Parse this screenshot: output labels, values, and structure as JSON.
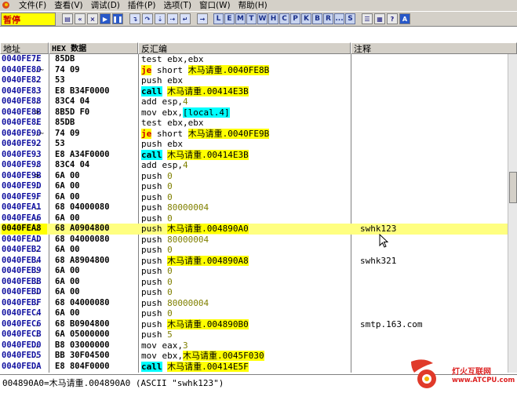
{
  "menu": {
    "items": [
      "文件(F)",
      "查看(V)",
      "调试(D)",
      "插件(P)",
      "选项(T)",
      "窗口(W)",
      "帮助(H)"
    ]
  },
  "toolbar": {
    "status": "暂停",
    "letters": [
      "L",
      "E",
      "M",
      "T",
      "W",
      "H",
      "C",
      "P",
      "K",
      "B",
      "R",
      "...",
      "S"
    ]
  },
  "columns": {
    "address": "地址",
    "hex": "HEX 数据",
    "disasm": "反汇编",
    "comment": "注释"
  },
  "rows": [
    {
      "addr": "0040FE7E",
      "mark": ".",
      "hex": "85DB",
      "asm": [
        {
          "t": "test ebx,ebx"
        }
      ],
      "cmt": ""
    },
    {
      "addr": "0040FE80",
      "mark": ".~",
      "hex": "74 09",
      "asm": [
        {
          "t": "je",
          "c": "jmp"
        },
        {
          "t": " short "
        },
        {
          "t": "木马请重.0040FE8B",
          "c": "tgt"
        }
      ],
      "cmt": ""
    },
    {
      "addr": "0040FE82",
      "mark": ".",
      "hex": "53",
      "asm": [
        {
          "t": "push ebx"
        }
      ],
      "cmt": ""
    },
    {
      "addr": "0040FE83",
      "mark": ".",
      "hex": "E8 B34F0000",
      "asm": [
        {
          "t": "call",
          "c": "call"
        },
        {
          "t": " "
        },
        {
          "t": "木马请重.00414E3B",
          "c": "tgt"
        }
      ],
      "cmt": ""
    },
    {
      "addr": "0040FE88",
      "mark": ".",
      "hex": "83C4 04",
      "asm": [
        {
          "t": "add esp,"
        },
        {
          "t": "4",
          "c": "num"
        }
      ],
      "cmt": ""
    },
    {
      "addr": "0040FE8B",
      "mark": ">",
      "hex": "8B5D F0",
      "asm": [
        {
          "t": "mov ebx,"
        },
        {
          "t": "[local.4]",
          "c": "local"
        }
      ],
      "cmt": ""
    },
    {
      "addr": "0040FE8E",
      "mark": ".",
      "hex": "85DB",
      "asm": [
        {
          "t": "test ebx,ebx"
        }
      ],
      "cmt": ""
    },
    {
      "addr": "0040FE90",
      "mark": ".~",
      "hex": "74 09",
      "asm": [
        {
          "t": "je",
          "c": "jmp"
        },
        {
          "t": " short "
        },
        {
          "t": "木马请重.0040FE9B",
          "c": "tgt"
        }
      ],
      "cmt": ""
    },
    {
      "addr": "0040FE92",
      "mark": ".",
      "hex": "53",
      "asm": [
        {
          "t": "push ebx"
        }
      ],
      "cmt": ""
    },
    {
      "addr": "0040FE93",
      "mark": ".",
      "hex": "E8 A34F0000",
      "asm": [
        {
          "t": "call",
          "c": "call"
        },
        {
          "t": " "
        },
        {
          "t": "木马请重.00414E3B",
          "c": "tgt"
        }
      ],
      "cmt": ""
    },
    {
      "addr": "0040FE98",
      "mark": ".",
      "hex": "83C4 04",
      "asm": [
        {
          "t": "add esp,"
        },
        {
          "t": "4",
          "c": "num"
        }
      ],
      "cmt": ""
    },
    {
      "addr": "0040FE9B",
      "mark": ">",
      "hex": "6A 00",
      "asm": [
        {
          "t": "push "
        },
        {
          "t": "0",
          "c": "num"
        }
      ],
      "cmt": ""
    },
    {
      "addr": "0040FE9D",
      "mark": ".",
      "hex": "6A 00",
      "asm": [
        {
          "t": "push "
        },
        {
          "t": "0",
          "c": "num"
        }
      ],
      "cmt": ""
    },
    {
      "addr": "0040FE9F",
      "mark": ".",
      "hex": "6A 00",
      "asm": [
        {
          "t": "push "
        },
        {
          "t": "0",
          "c": "num"
        }
      ],
      "cmt": ""
    },
    {
      "addr": "0040FEA1",
      "mark": ".",
      "hex": "68 04000080",
      "asm": [
        {
          "t": "push "
        },
        {
          "t": "80000004",
          "c": "num"
        }
      ],
      "cmt": ""
    },
    {
      "addr": "0040FEA6",
      "mark": ".",
      "hex": "6A 00",
      "asm": [
        {
          "t": "push "
        },
        {
          "t": "0",
          "c": "num"
        }
      ],
      "cmt": ""
    },
    {
      "addr": "0040FEA8",
      "mark": ".",
      "hex": "68 A0904800",
      "asm": [
        {
          "t": "push "
        },
        {
          "t": "木马请重.004890A0",
          "c": "tgt"
        }
      ],
      "cmt": "swhk123",
      "selected": true
    },
    {
      "addr": "0040FEAD",
      "mark": ".",
      "hex": "68 04000080",
      "asm": [
        {
          "t": "push "
        },
        {
          "t": "80000004",
          "c": "num"
        }
      ],
      "cmt": ""
    },
    {
      "addr": "0040FEB2",
      "mark": ".",
      "hex": "6A 00",
      "asm": [
        {
          "t": "push "
        },
        {
          "t": "0",
          "c": "num"
        }
      ],
      "cmt": ""
    },
    {
      "addr": "0040FEB4",
      "mark": ".",
      "hex": "68 A8904800",
      "asm": [
        {
          "t": "push "
        },
        {
          "t": "木马请重.004890A8",
          "c": "tgt"
        }
      ],
      "cmt": "swhk321"
    },
    {
      "addr": "0040FEB9",
      "mark": ".",
      "hex": "6A 00",
      "asm": [
        {
          "t": "push "
        },
        {
          "t": "0",
          "c": "num"
        }
      ],
      "cmt": ""
    },
    {
      "addr": "0040FEBB",
      "mark": ".",
      "hex": "6A 00",
      "asm": [
        {
          "t": "push "
        },
        {
          "t": "0",
          "c": "num"
        }
      ],
      "cmt": ""
    },
    {
      "addr": "0040FEBD",
      "mark": ".",
      "hex": "6A 00",
      "asm": [
        {
          "t": "push "
        },
        {
          "t": "0",
          "c": "num"
        }
      ],
      "cmt": ""
    },
    {
      "addr": "0040FEBF",
      "mark": ".",
      "hex": "68 04000080",
      "asm": [
        {
          "t": "push "
        },
        {
          "t": "80000004",
          "c": "num"
        }
      ],
      "cmt": ""
    },
    {
      "addr": "0040FEC4",
      "mark": ".",
      "hex": "6A 00",
      "asm": [
        {
          "t": "push "
        },
        {
          "t": "0",
          "c": "num"
        }
      ],
      "cmt": ""
    },
    {
      "addr": "0040FEC6",
      "mark": ".",
      "hex": "68 B0904800",
      "asm": [
        {
          "t": "push "
        },
        {
          "t": "木马请重.004890B0",
          "c": "tgt"
        }
      ],
      "cmt": "smtp.163.com"
    },
    {
      "addr": "0040FECB",
      "mark": ".",
      "hex": "6A 05000000",
      "asm": [
        {
          "t": "push "
        },
        {
          "t": "5",
          "c": "num"
        }
      ],
      "cmt": ""
    },
    {
      "addr": "0040FED0",
      "mark": ".",
      "hex": "B8 03000000",
      "asm": [
        {
          "t": "mov eax,"
        },
        {
          "t": "3",
          "c": "num"
        }
      ],
      "cmt": ""
    },
    {
      "addr": "0040FED5",
      "mark": ".",
      "hex": "BB 30F04500",
      "asm": [
        {
          "t": "mov ebx,"
        },
        {
          "t": "木马请重.0045F030",
          "c": "tgt"
        }
      ],
      "cmt": ""
    },
    {
      "addr": "0040FEDA",
      "mark": ".",
      "hex": "E8 804F0000",
      "asm": [
        {
          "t": "call",
          "c": "call"
        },
        {
          "t": " "
        },
        {
          "t": "木马请重.00414E5F",
          "c": "tgt"
        }
      ],
      "cmt": ""
    }
  ],
  "status_bar": {
    "text": "004890A0=木马请重.004890A0 (ASCII \"swhk123\")"
  },
  "watermark": {
    "line1": "灯火互联网",
    "line2": "www.ATCPU.com"
  }
}
